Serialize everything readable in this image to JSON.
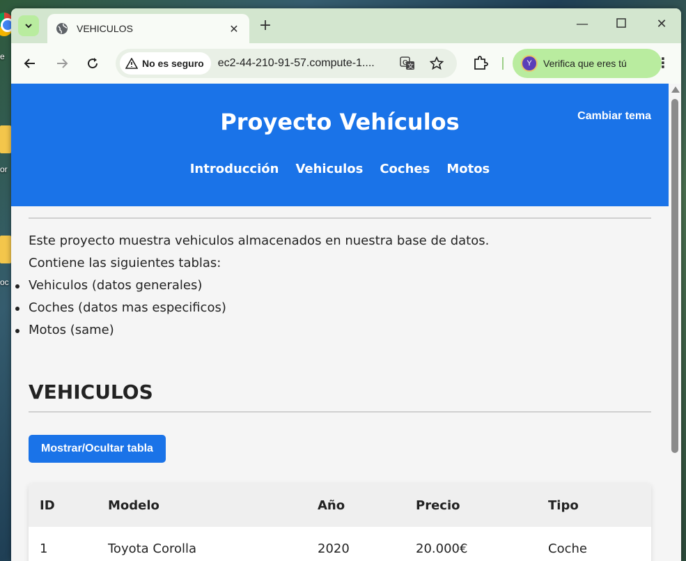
{
  "desktop": {
    "labels": [
      "e",
      "or",
      "oc"
    ]
  },
  "browser": {
    "tab_title": "VEHICULOS",
    "security_label": "No es seguro",
    "url": "ec2-44-210-91-57.compute-1....",
    "profile_label": "Verifica que eres tú",
    "profile_initial": "Y"
  },
  "site": {
    "title": "Proyecto Vehículos",
    "theme_button": "Cambiar tema",
    "nav": [
      "Introducción",
      "Vehiculos",
      "Coches",
      "Motos"
    ]
  },
  "intro": {
    "lines": [
      "Este proyecto muestra vehiculos almacenados en nuestra base de datos.",
      "Contiene las siguientes tablas:"
    ],
    "items": [
      "Vehiculos (datos generales)",
      "Coches (datos mas especificos)",
      "Motos (same)"
    ]
  },
  "vehiculos": {
    "title": "VEHICULOS",
    "toggle_button": "Mostrar/Ocultar tabla",
    "columns": [
      "ID",
      "Modelo",
      "Año",
      "Precio",
      "Tipo"
    ],
    "rows": [
      [
        "1",
        "Toyota Corolla",
        "2020",
        "20.000€",
        "Coche"
      ]
    ]
  },
  "colors": {
    "accent": "#1a73e8",
    "tabstrip": "#d3e6cf",
    "profile_chip": "#b9ec9f"
  }
}
